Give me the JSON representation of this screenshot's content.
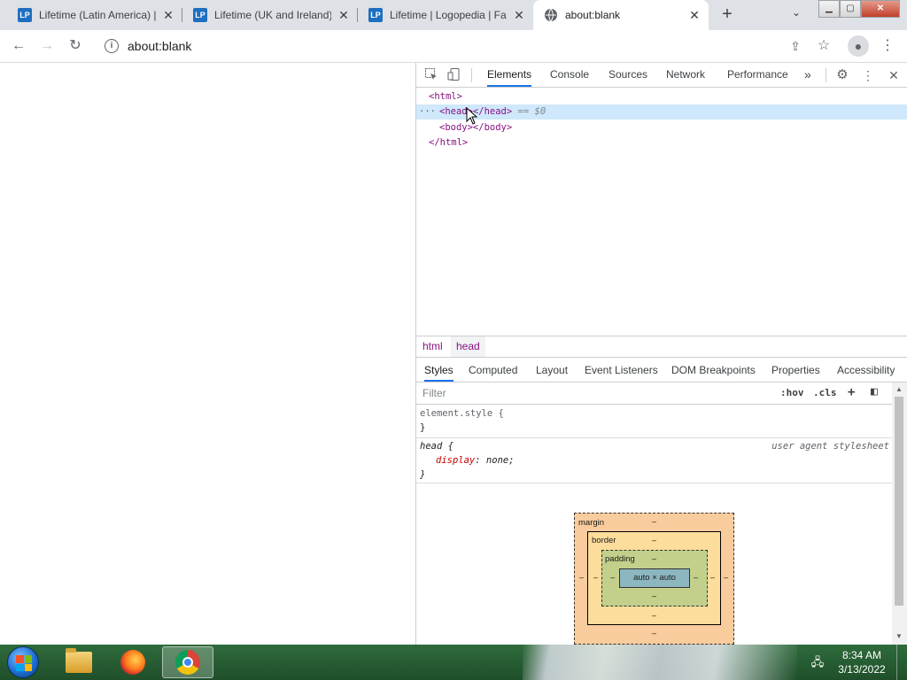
{
  "tabs": [
    {
      "title": "Lifetime (Latin America) |",
      "favicon": "LP",
      "close": "✕"
    },
    {
      "title": "Lifetime (UK and Ireland)",
      "favicon": "LP",
      "close": "✕"
    },
    {
      "title": "Lifetime | Logopedia | Fa",
      "favicon": "LP",
      "close": "✕"
    },
    {
      "title": "about:blank",
      "favicon": "globe-icon",
      "close": "✕"
    }
  ],
  "new_tab_label": "+",
  "tab_search_label": "⌄",
  "window_buttons": {
    "minimize": "▁",
    "restore": "▢",
    "close": "✕"
  },
  "toolbar": {
    "back": "←",
    "forward": "→",
    "reload": "↻",
    "url": "about:blank",
    "info": "i",
    "share": "⇪",
    "star": "☆",
    "profile": "●",
    "menu": "⋮"
  },
  "devtools": {
    "tabs": [
      "Elements",
      "Console",
      "Sources",
      "Network",
      "Performance"
    ],
    "more_tabs": "»",
    "settings": "⚙",
    "kebab": "⋮",
    "close": "✕",
    "dom": {
      "html_open": "<html>",
      "head_open": "<head>",
      "head_close": "</head>",
      "eq": "== $0",
      "body": "<body></body>",
      "html_close": "</html>",
      "dots": "···"
    },
    "breadcrumbs": [
      "html",
      "head"
    ],
    "style_tabs": [
      "Styles",
      "Computed",
      "Layout",
      "Event Listeners",
      "DOM Breakpoints",
      "Properties",
      "Accessibility"
    ],
    "filter_placeholder": "Filter",
    "filter_tools": {
      "hov": ":hov",
      "cls": ".cls",
      "plus": "+",
      "toggle": "◧"
    },
    "rules": {
      "element_style_open": "element.style {",
      "element_style_close": "}",
      "head_selector": "head {",
      "head_prop": "display",
      "head_value": "none;",
      "head_close": "}",
      "source": "user agent stylesheet"
    },
    "box_model": {
      "margin_label": "margin",
      "border_label": "border",
      "padding_label": "padding",
      "content": "auto × auto",
      "dash": "–"
    }
  },
  "taskbar": {
    "clock_time": "8:34 AM",
    "clock_date": "3/13/2022"
  }
}
